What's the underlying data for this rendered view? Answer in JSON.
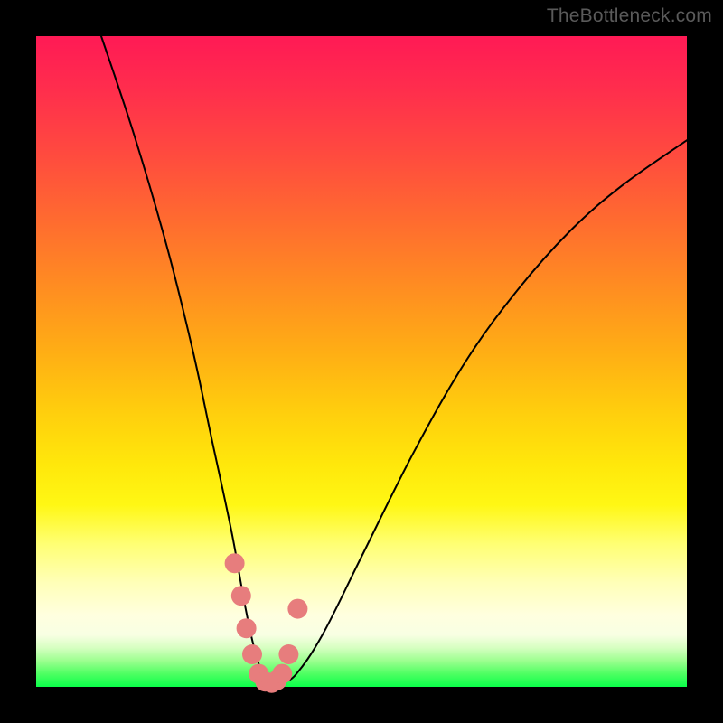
{
  "watermark": "TheBottleneck.com",
  "chart_data": {
    "type": "line",
    "title": "",
    "xlabel": "",
    "ylabel": "",
    "xlim": [
      0,
      100
    ],
    "ylim": [
      0,
      100
    ],
    "grid": false,
    "legend": false,
    "series": [
      {
        "name": "bottleneck-curve",
        "x": [
          10,
          15,
          20,
          24,
          27,
          30,
          32,
          33.5,
          35,
          36.5,
          38,
          40,
          44,
          50,
          58,
          66,
          74,
          82,
          90,
          100
        ],
        "values": [
          100,
          85,
          68,
          52,
          38,
          24,
          13,
          6,
          1.5,
          0.5,
          0.8,
          2,
          8,
          20,
          36,
          50,
          61,
          70,
          77,
          84
        ]
      }
    ],
    "markers": {
      "name": "highlight-dots",
      "x": [
        30.5,
        31.5,
        32.3,
        33.2,
        34.2,
        35.2,
        36.2,
        37.0,
        37.8,
        38.8,
        40.2
      ],
      "values": [
        19,
        14,
        9,
        5,
        2,
        0.8,
        0.6,
        1.0,
        2.0,
        5,
        12
      ]
    },
    "background_gradient": {
      "top": "#ff1a55",
      "mid": "#ffe80b",
      "bottom": "#0bff4a"
    }
  }
}
